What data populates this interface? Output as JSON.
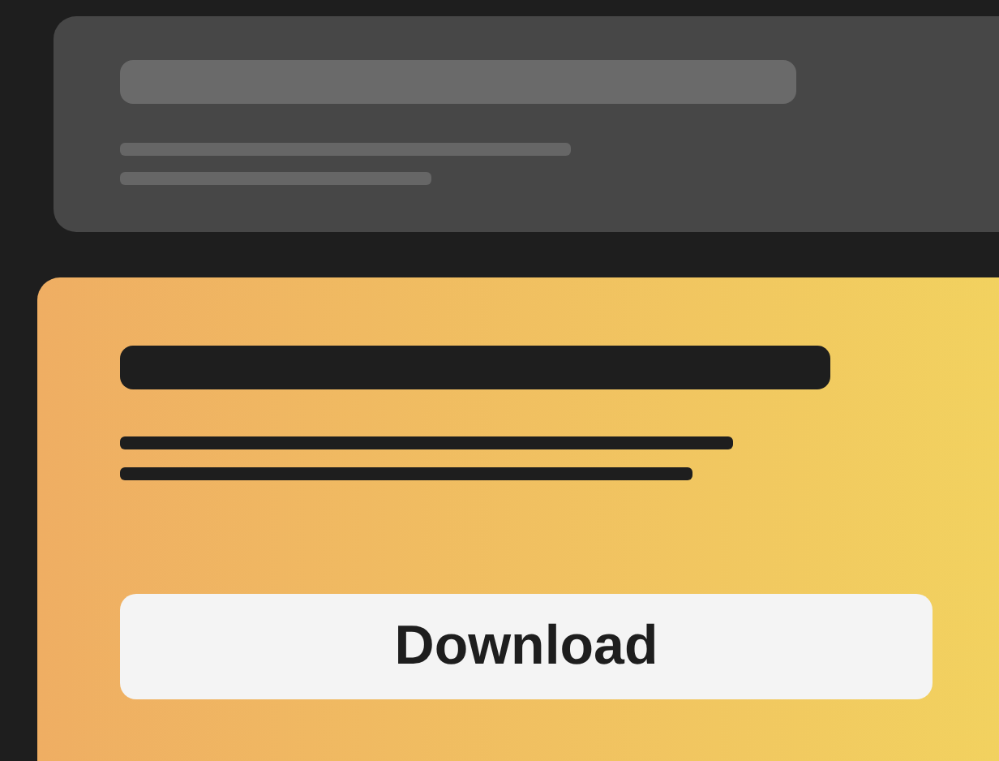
{
  "cards": [
    {
      "selected": false
    },
    {
      "selected": true,
      "button": {
        "label": "Download"
      }
    }
  ]
}
